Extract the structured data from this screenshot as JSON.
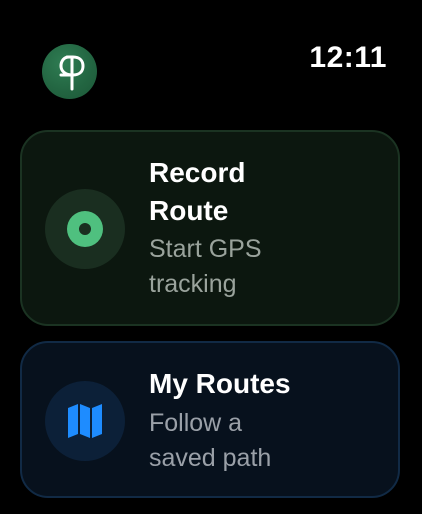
{
  "status_bar": {
    "time": "12:11"
  },
  "app": {
    "logo_icon": "route-logo-icon",
    "colors": {
      "logo_green": "#236642",
      "record_accent": "#4fc07f",
      "routes_accent": "#1e8cff"
    }
  },
  "cards": [
    {
      "title": "Record Route",
      "subtitle": "Start GPS tracking",
      "icon": "record-dot-icon"
    },
    {
      "title": "My Routes",
      "subtitle": "Follow a saved path",
      "icon": "map-icon"
    }
  ]
}
